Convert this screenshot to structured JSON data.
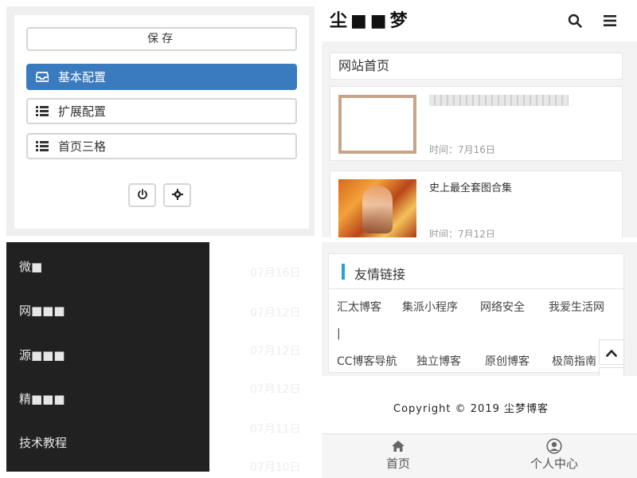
{
  "config_panel": {
    "save_label": "保存",
    "menu": [
      {
        "label": "基本配置",
        "icon": "inbox-icon",
        "active": true
      },
      {
        "label": "扩展配置",
        "icon": "list-icon",
        "active": false
      },
      {
        "label": "首页三格",
        "icon": "list-icon",
        "active": false
      }
    ],
    "accent_color": "#3a7bbf"
  },
  "site": {
    "logo": "尘■■梦",
    "section_title": "网站首页",
    "articles": [
      {
        "title": "",
        "time": "时间：7月16日"
      },
      {
        "title": "史上最全套图合集",
        "time": "时间：7月12日"
      }
    ]
  },
  "side_menu": {
    "items": [
      "微■",
      "网■■■",
      "源■■■",
      "精■■■",
      "技术教程"
    ],
    "dates": [
      "07月16日",
      "07月12日",
      "07月12日",
      "07月12日",
      "07月11日",
      "07月10日"
    ]
  },
  "friend_links": {
    "title": "友情链接",
    "row1": [
      "汇太博客",
      "集派小程序",
      "网络安全",
      "我爱生活网"
    ],
    "row2": [
      "|"
    ],
    "row3": [
      "CC博客导航",
      "独立博客",
      "原创博客",
      "极简指南"
    ],
    "accent_color": "#2a9fd6"
  },
  "footer": {
    "copyright": "Copyright © 2019 尘梦博客"
  },
  "tabbar": {
    "home_label": "首页",
    "profile_label": "个人中心"
  }
}
